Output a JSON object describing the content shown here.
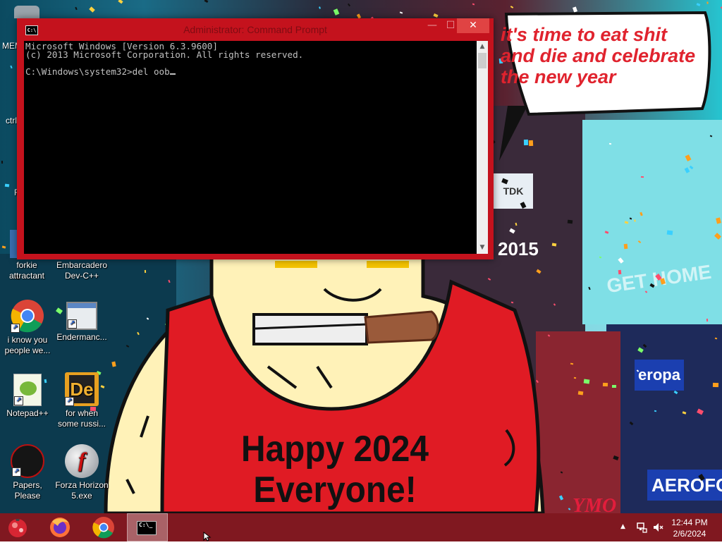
{
  "wallpaper": {
    "speech_bubble": [
      "it's time to eat shit",
      "and die and celebrate",
      "the new year"
    ],
    "banner": [
      "Happy 2024",
      "Everyone!"
    ],
    "signs": {
      "tdk": "TDK",
      "get_home": "GET HOME",
      "europa": "eropa",
      "aerofos": "AEROFOS",
      "year": "2015",
      "signature": "YMO"
    },
    "colors": {
      "shirt": "#e01b24",
      "skin": "#fff2b8",
      "speech_text": "#e0232e"
    }
  },
  "desktop": {
    "icons": [
      {
        "id": "forkie",
        "label": [
          "forkie",
          "attractant"
        ],
        "icon": "app-icon"
      },
      {
        "id": "embarcadero",
        "label": [
          "Embarcadero",
          "Dev-C++"
        ],
        "icon": "devcpp-icon"
      },
      {
        "id": "chrome",
        "label": [
          "i know you",
          "people we..."
        ],
        "icon": "chrome-icon"
      },
      {
        "id": "endermanch",
        "label": [
          "Endermanc..."
        ],
        "icon": "window-icon"
      },
      {
        "id": "notepadpp",
        "label": [
          "Notepad++"
        ],
        "icon": "notepadpp-icon"
      },
      {
        "id": "russian",
        "label": [
          "for when",
          "some russi..."
        ],
        "icon": "de-icon"
      },
      {
        "id": "papers",
        "label": [
          "Papers, Please"
        ],
        "icon": "papers-please-icon"
      },
      {
        "id": "forza",
        "label": [
          "Forza Horizon",
          "5.exe"
        ],
        "icon": "flash-icon"
      }
    ],
    "partial_labels": {
      "mem": "MEM",
      "ctrl": "ctrl-",
      "f": "F"
    }
  },
  "cmd_window": {
    "title": "Administrator: Command Prompt",
    "controls": {
      "minimize": "—",
      "maximize": "☐",
      "close": "✕"
    },
    "lines": [
      "Microsoft Windows [Version 6.3.9600]",
      "(c) 2013 Microsoft Corporation. All rights reserved.",
      "",
      "C:\\Windows\\system32>del oob"
    ],
    "title_icon": "C:\\",
    "scroll_up": "▲",
    "scroll_down": "▼"
  },
  "taskbar": {
    "items": [
      {
        "id": "start",
        "icon": "start-orb-icon",
        "active": false
      },
      {
        "id": "firefox",
        "icon": "firefox-icon",
        "active": false
      },
      {
        "id": "chrome",
        "icon": "chrome-icon",
        "active": false
      },
      {
        "id": "cmd",
        "icon": "cmd-icon",
        "active": true
      }
    ],
    "cmd_icon_text": "C:\\_",
    "tray": {
      "time": "12:44 PM",
      "date": "2/6/2024",
      "icons": [
        "chevron-up-icon",
        "network-icon",
        "volume-muted-icon"
      ],
      "chevron": "▲"
    }
  }
}
